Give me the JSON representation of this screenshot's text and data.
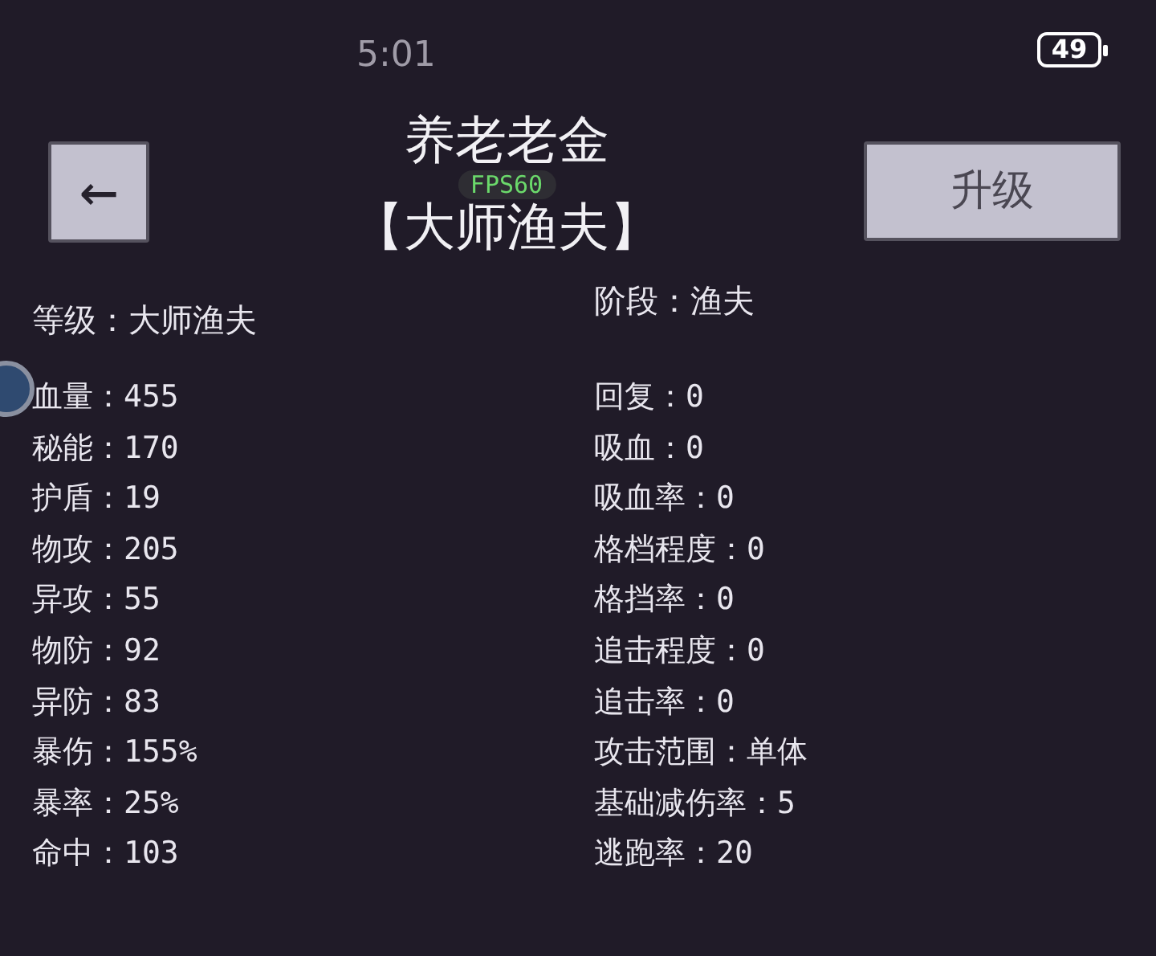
{
  "status_bar": {
    "time": "5:01",
    "battery": "49"
  },
  "header": {
    "back_button": "←",
    "title": "养老老金",
    "subtitle": "【大师渔夫】",
    "fps": "FPS60",
    "upgrade_button": "升级"
  },
  "level": {
    "label": "等级：",
    "value": "大师渔夫"
  },
  "stage": {
    "label": "阶段：",
    "value": "渔夫"
  },
  "stats_left": [
    {
      "label": "血量：",
      "value": "455"
    },
    {
      "label": "秘能：",
      "value": "170"
    },
    {
      "label": "护盾：",
      "value": "19"
    },
    {
      "label": "物攻：",
      "value": "205"
    },
    {
      "label": "异攻：",
      "value": "55"
    },
    {
      "label": "物防：",
      "value": "92"
    },
    {
      "label": "异防：",
      "value": "83"
    },
    {
      "label": "暴伤：",
      "value": "155%"
    },
    {
      "label": "暴率：",
      "value": "25%"
    },
    {
      "label": "命中：",
      "value": "103"
    }
  ],
  "stats_right": [
    {
      "label": "回复：",
      "value": "0"
    },
    {
      "label": "吸血：",
      "value": "0"
    },
    {
      "label": "吸血率：",
      "value": "0"
    },
    {
      "label": "格档程度：",
      "value": "0"
    },
    {
      "label": "格挡率：",
      "value": "0"
    },
    {
      "label": "追击程度：",
      "value": "0"
    },
    {
      "label": "追击率：",
      "value": "0"
    },
    {
      "label": "攻击范围：",
      "value": "单体"
    },
    {
      "label": "基础减伤率：",
      "value": "5"
    },
    {
      "label": "逃跑率：",
      "value": "20"
    }
  ]
}
